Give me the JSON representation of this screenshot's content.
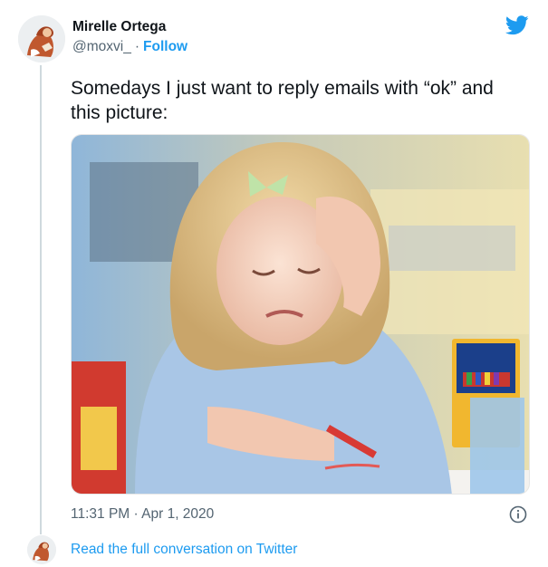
{
  "user": {
    "name": "Mirelle Ortega",
    "handle": "@moxvi_",
    "separator": "·",
    "follow_label": "Follow"
  },
  "tweet": {
    "text": "Somedays I just want to reply emails with “ok” and this picture:",
    "time": "11:31 PM",
    "date_separator": "·",
    "date": "Apr 1, 2020"
  },
  "footer": {
    "read_more_label": "Read the full conversation on Twitter"
  },
  "icons": {
    "brand": "twitter-bird-icon",
    "info": "info-icon"
  },
  "colors": {
    "accent": "#1d9bf0",
    "secondary_text": "#536471",
    "primary_text": "#0f1419"
  }
}
